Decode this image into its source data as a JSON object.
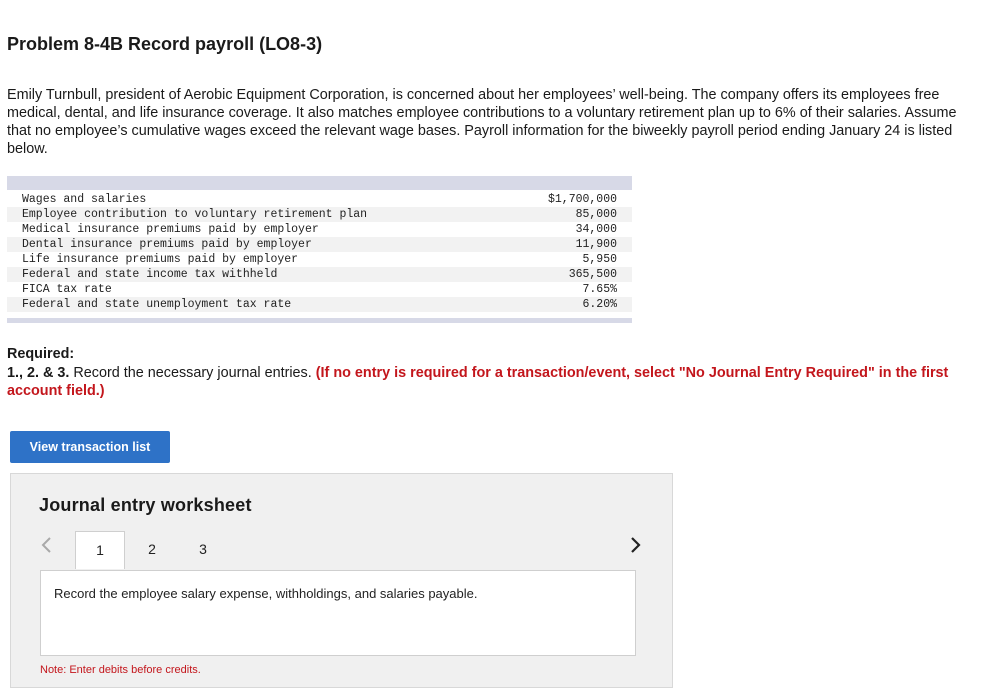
{
  "problem": {
    "title": "Problem 8-4B Record payroll (LO8-3)",
    "intro": "Emily Turnbull, president of Aerobic Equipment Corporation, is concerned about her employees’ well-being. The company offers its employees free medical, dental, and life insurance coverage. It also matches employee contributions to a voluntary retirement plan up to 6% of their salaries. Assume that no employee’s cumulative wages exceed the relevant wage bases. Payroll information for the biweekly payroll period ending January 24 is listed below."
  },
  "payroll_table": [
    {
      "label": "Wages and salaries",
      "value": "$1,700,000"
    },
    {
      "label": "Employee contribution to voluntary retirement plan",
      "value": "85,000"
    },
    {
      "label": "Medical insurance premiums paid by employer",
      "value": "34,000"
    },
    {
      "label": "Dental insurance premiums paid by employer",
      "value": "11,900"
    },
    {
      "label": "Life insurance premiums paid by employer",
      "value": "5,950"
    },
    {
      "label": "Federal and state income tax withheld",
      "value": "365,500"
    },
    {
      "label": "FICA tax rate",
      "value": "7.65%"
    },
    {
      "label": "Federal and state unemployment tax rate",
      "value": "6.20%"
    }
  ],
  "required": {
    "heading": "Required:",
    "numbers": "1., 2. & 3.",
    "text": " Record the necessary journal entries. ",
    "note": "(If no entry is required for a transaction/event, select \"No Journal Entry Required\" in the first account field.)"
  },
  "buttons": {
    "view_transactions": "View transaction list"
  },
  "worksheet": {
    "title": "Journal entry worksheet",
    "prev_icon": "‹",
    "next_icon": "›",
    "tabs": [
      "1",
      "2",
      "3"
    ],
    "active_tab": 0,
    "instruction": "Record the employee salary expense, withholdings, and salaries payable.",
    "note": "Note: Enter debits before credits."
  }
}
